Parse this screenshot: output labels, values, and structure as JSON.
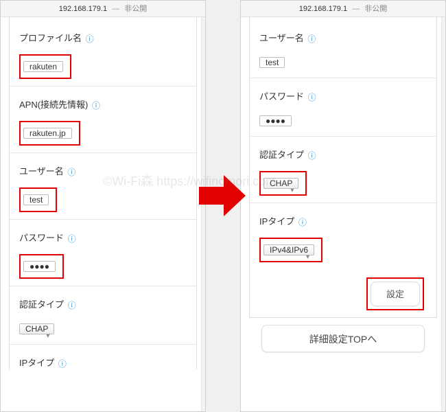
{
  "address": {
    "ip": "192.168.179.1",
    "privacy": "非公開"
  },
  "left": {
    "profile_name": {
      "label": "プロファイル名",
      "value": "rakuten"
    },
    "apn": {
      "label": "APN(接続先情報)",
      "value": "rakuten.jp"
    },
    "username": {
      "label": "ユーザー名",
      "value": "test"
    },
    "password": {
      "label": "パスワード",
      "value": "●●●●"
    },
    "auth_type": {
      "label": "認証タイプ",
      "value": "CHAP"
    },
    "ip_type": {
      "label": "IPタイプ"
    }
  },
  "right": {
    "username": {
      "label": "ユーザー名",
      "value": "test"
    },
    "password": {
      "label": "パスワード",
      "value": "●●●●"
    },
    "auth_type": {
      "label": "認証タイプ",
      "value": "CHAP"
    },
    "ip_type": {
      "label": "IPタイプ",
      "value": "IPv4&IPv6"
    },
    "apply_button": "設定",
    "back_button": "詳細設定TOPへ"
  },
  "watermark": "©Wi-Fi森   https://wifinomori.com"
}
